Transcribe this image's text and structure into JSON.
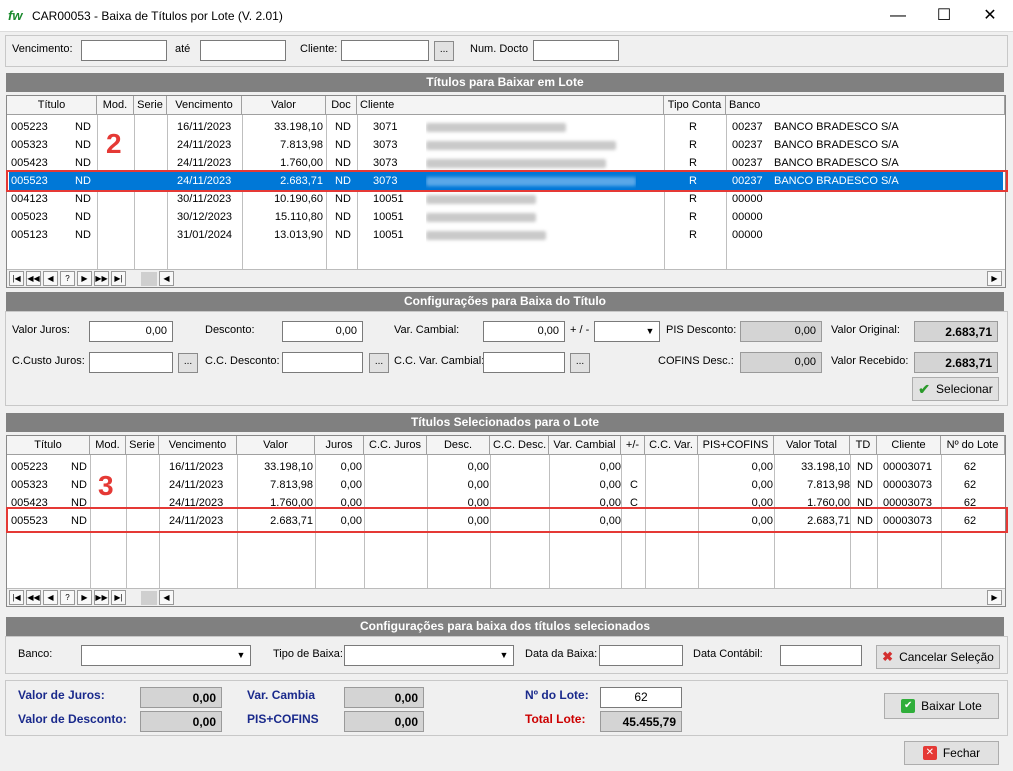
{
  "window": {
    "logo": "fw",
    "title": "CAR00053 - Baixa de Títulos por Lote   (V. 2.01)",
    "minimize": "—",
    "maximize": "☐",
    "close": "✕"
  },
  "filters": {
    "vencimento": "Vencimento:",
    "ate": "até",
    "cliente": "Cliente:",
    "num_docto": "Num. Docto",
    "browse": "..."
  },
  "grid1": {
    "title": "Títulos para Baixar em Lote",
    "headers": [
      "Título",
      "Mod.",
      "Serie",
      "Vencimento",
      "Valor",
      "Doc",
      "Cliente",
      "Tipo Conta",
      "Banco"
    ],
    "rows": [
      [
        "005223",
        "ND",
        "",
        "16/11/2023",
        "33.198,10",
        "ND",
        "3071",
        "",
        "R",
        "00237",
        "BANCO BRADESCO S/A"
      ],
      [
        "005323",
        "ND",
        "",
        "24/11/2023",
        "7.813,98",
        "ND",
        "3073",
        "",
        "R",
        "00237",
        "BANCO BRADESCO S/A"
      ],
      [
        "005423",
        "ND",
        "",
        "24/11/2023",
        "1.760,00",
        "ND",
        "3073",
        "",
        "R",
        "00237",
        "BANCO BRADESCO S/A"
      ],
      [
        "005523",
        "ND",
        "",
        "24/11/2023",
        "2.683,71",
        "ND",
        "3073",
        "",
        "R",
        "00237",
        "BANCO BRADESCO S/A"
      ],
      [
        "004123",
        "ND",
        "",
        "30/11/2023",
        "10.190,60",
        "ND",
        "10051",
        "",
        "R",
        "00000",
        ""
      ],
      [
        "005023",
        "ND",
        "",
        "30/12/2023",
        "15.110,80",
        "ND",
        "10051",
        "",
        "R",
        "00000",
        ""
      ],
      [
        "005123",
        "ND",
        "",
        "31/01/2024",
        "13.013,90",
        "ND",
        "10051",
        "",
        "R",
        "00000",
        ""
      ]
    ],
    "marker": "2"
  },
  "nav": [
    "|◀",
    "◀◀",
    "◀",
    "?",
    "▶",
    "▶▶",
    "▶|"
  ],
  "config": {
    "title": "Configurações para Baixa do Título",
    "valor_juros": "Valor Juros:",
    "valor_juros_val": "0,00",
    "desconto": "Desconto:",
    "desconto_val": "0,00",
    "var_cambial": "Var. Cambial:",
    "var_cambial_val": "0,00",
    "sinal": "+ / -",
    "pis_desconto": "PIS Desconto:",
    "pis_desconto_val": "0,00",
    "valor_original": "Valor Original:",
    "valor_original_val": "2.683,71",
    "cc_juros": "C.Custo Juros:",
    "cc_desconto": "C.C. Desconto:",
    "cc_var_cambial": "C.C. Var. Cambial:",
    "cofins_desc": "COFINS Desc.:",
    "cofins_desc_val": "0,00",
    "valor_recebido": "Valor Recebido:",
    "valor_recebido_val": "2.683,71",
    "selecionar": "Selecionar"
  },
  "grid2": {
    "title": "Títulos Selecionados para o Lote",
    "headers": [
      "Título",
      "Mod.",
      "Serie",
      "Vencimento",
      "Valor",
      "Juros",
      "C.C. Juros",
      "Desc.",
      "C.C. Desc.",
      "Var. Cambial",
      "+/-",
      "C.C. Var.",
      "PIS+COFINS",
      "Valor Total",
      "TD",
      "Cliente",
      "Nº do Lote"
    ],
    "rows": [
      [
        "005223",
        "ND",
        "",
        "16/11/2023",
        "33.198,10",
        "0,00",
        "",
        "0,00",
        "",
        "0,00",
        "",
        "",
        "0,00",
        "33.198,10",
        "ND",
        "00003071",
        "62"
      ],
      [
        "005323",
        "ND",
        "",
        "24/11/2023",
        "7.813,98",
        "0,00",
        "",
        "0,00",
        "",
        "0,00",
        "C",
        "",
        "0,00",
        "7.813,98",
        "ND",
        "00003073",
        "62"
      ],
      [
        "005423",
        "ND",
        "",
        "24/11/2023",
        "1.760,00",
        "0,00",
        "",
        "0,00",
        "",
        "0,00",
        "C",
        "",
        "0,00",
        "1.760,00",
        "ND",
        "00003073",
        "62"
      ],
      [
        "005523",
        "ND",
        "",
        "24/11/2023",
        "2.683,71",
        "0,00",
        "",
        "0,00",
        "",
        "0,00",
        "",
        "",
        "0,00",
        "2.683,71",
        "ND",
        "00003073",
        "62"
      ]
    ],
    "marker": "3"
  },
  "batch": {
    "title": "Configurações para baixa dos títulos selecionados",
    "banco": "Banco:",
    "tipo_baixa": "Tipo de Baixa:",
    "data_baixa": "Data da Baixa:",
    "data_contabil": "Data Contábil:",
    "cancelar": "Cancelar Seleção"
  },
  "totals": {
    "valor_juros": "Valor de Juros:",
    "valor_juros_val": "0,00",
    "valor_desconto": "Valor de Desconto:",
    "valor_desconto_val": "0,00",
    "var_cambia": "Var. Cambia",
    "var_cambia_val": "0,00",
    "pis_cofins": "PIS+COFINS",
    "pis_cofins_val": "0,00",
    "num_lote": "Nº do Lote:",
    "num_lote_val": "62",
    "total_lote": "Total Lote:",
    "total_lote_val": "45.455,79",
    "baixar": "Baixar Lote",
    "fechar": "Fechar"
  },
  "colors": {
    "selection": "#0078d7",
    "highlight": "#e53935",
    "header": "#808080"
  }
}
